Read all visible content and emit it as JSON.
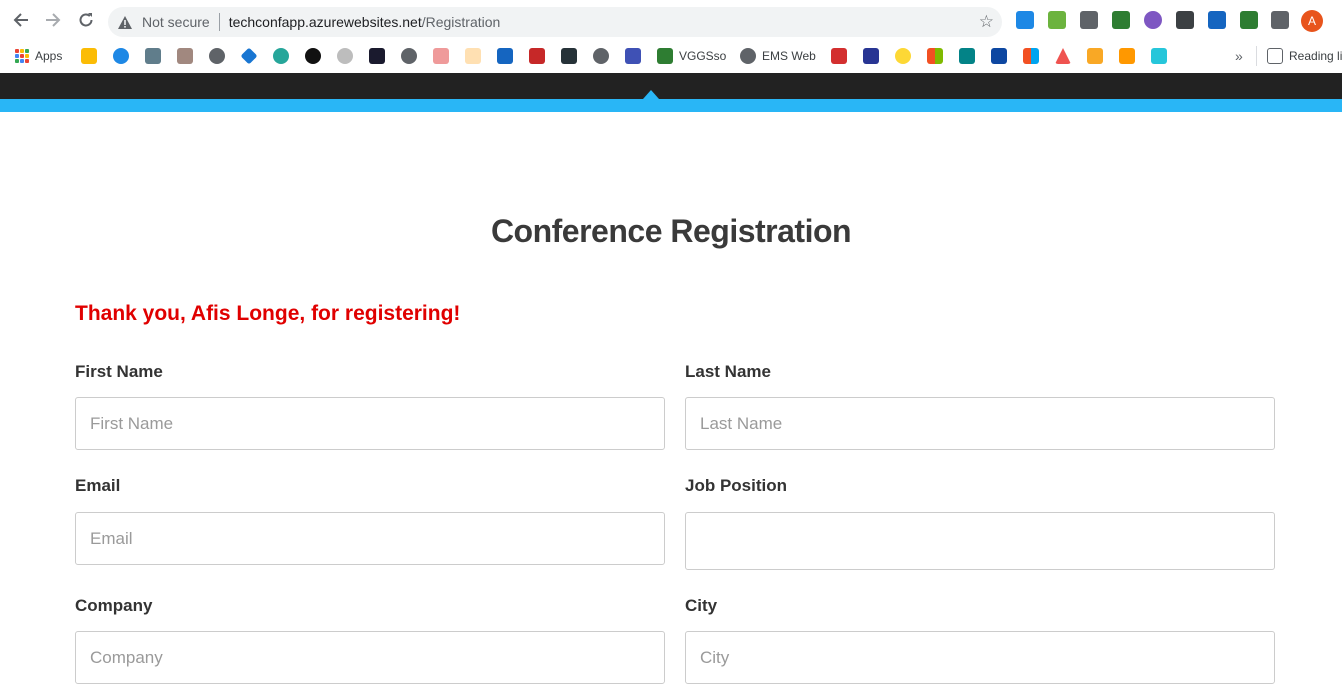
{
  "browser": {
    "address": {
      "security_label": "Not secure",
      "url_host": "techconfapp.azurewebsites.net",
      "url_path": "/Registration"
    },
    "profile_initial": "A"
  },
  "bookmarks": {
    "apps_label": "Apps",
    "vggsso_label": "VGGSso",
    "emsweb_label": "EMS Web",
    "overflow": "»",
    "reading_list": "Reading li"
  },
  "page": {
    "title": "Conference Registration",
    "thank_you_message": "Thank you, Afis Longe, for registering!"
  },
  "form": {
    "first_name": {
      "label": "First Name",
      "placeholder": "First Name",
      "value": ""
    },
    "last_name": {
      "label": "Last Name",
      "placeholder": "Last Name",
      "value": ""
    },
    "email": {
      "label": "Email",
      "placeholder": "Email",
      "value": ""
    },
    "job_position": {
      "label": "Job Position",
      "placeholder": "",
      "value": ""
    },
    "company": {
      "label": "Company",
      "placeholder": "Company",
      "value": ""
    },
    "city": {
      "label": "City",
      "placeholder": "City",
      "value": ""
    }
  },
  "colors": {
    "accent_band": "#29b6f6",
    "site_nav": "#222222",
    "thank_you_text": "#e00000"
  }
}
